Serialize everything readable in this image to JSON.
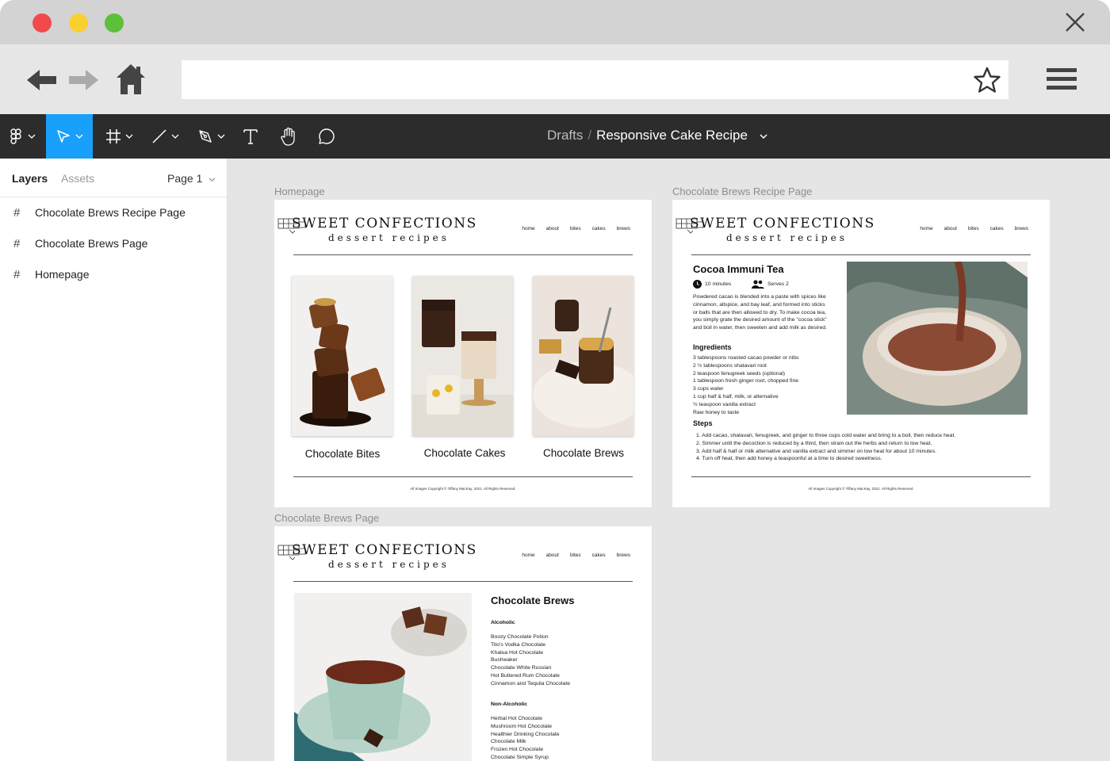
{
  "browser": {
    "url": ""
  },
  "toolbar": {
    "breadcrumb_root": "Drafts",
    "breadcrumb_sep": "/",
    "file_name": "Responsive Cake Recipe"
  },
  "sidebar": {
    "tab_layers": "Layers",
    "tab_assets": "Assets",
    "page_selector": "Page 1",
    "layers": [
      {
        "label": "Chocolate Brews Recipe Page"
      },
      {
        "label": "Chocolate Brews Page"
      },
      {
        "label": "Homepage"
      }
    ]
  },
  "site": {
    "brand_name": "SWEET CONFECTIONS",
    "brand_tagline": "dessert recipes",
    "nav": [
      "home",
      "about",
      "bites",
      "cakes",
      "brews"
    ],
    "copyright": "All Images Copyright © Tiffany MacKay, 2021. All Rights Reserved."
  },
  "frames": {
    "homepage": {
      "label": "Homepage",
      "cards": [
        {
          "title": "Chocolate Bites"
        },
        {
          "title": "Chocolate Cakes"
        },
        {
          "title": "Chocolate Brews"
        }
      ]
    },
    "recipe": {
      "label": "Chocolate Brews Recipe Page",
      "title": "Cocoa Immuni Tea",
      "time": "10 minutes",
      "serves": "Serves 2",
      "description": "Powdered cacao is blended into a paste with spices like cinnamon, allspice, and bay leaf, and formed into sticks or balls that are then allowed to dry. To make cocoa tea, you simply grate the desired amount of the \"cocoa stick\" and boil in water, then sweeten and add milk as desired.",
      "ingredients_heading": "Ingredients",
      "ingredients": [
        "3 tablespoons roasted cacao powder or nibs",
        "2 ½ tablespoons shatavari root",
        "2 teaspoon fenugreek seeds (optional)",
        "1 tablespoon fresh ginger root, chopped fine",
        "3 cups water",
        "1 cup half & half, milk, or alternative",
        "½ teaspoon vanilla extract",
        "Raw honey to taste"
      ],
      "steps_heading": "Steps",
      "steps": [
        "1. Add cacao, shatavari, fenugreek, and ginger to three cups cold water and bring to a boil, then reduce heat.",
        "2. Simmer until the decoction is reduced by a third, then strain out the herbs and return to low heat.",
        "3. Add half & half or milk alternative and vanilla extract and simmer on low heat for about 10 minutes.",
        "4. Turn off heat, then add honey a teaspoonful at a time to desired sweetness."
      ]
    },
    "brews": {
      "label": "Chocolate Brews Page",
      "title": "Chocolate Brews",
      "alcoholic_heading": "Alcoholic",
      "alcoholic": [
        "Boozy Chocolate Potion",
        "Tito's Vodka Chocolate",
        "Khalua Hot Chocolate",
        "Bushwaker",
        "Chocolate White Russian",
        "Hot Buttered Rum Chocolate",
        "Cinnamon and Tequila Chocolate"
      ],
      "non_alcoholic_heading": "Non-Alcoholic",
      "non_alcoholic": [
        "Herbal Hot Chocolate",
        "Mushroom Hot Chocolate",
        "Healthier Drinking Chocolate",
        "Chocolate Milk",
        "Frozen Hot Chocolate",
        "Chocolate Simple Syrup"
      ]
    }
  },
  "colors": {
    "figma_toolbar": "#2c2c2c",
    "active_tool": "#18a0fb",
    "canvas": "#e5e5e5"
  }
}
